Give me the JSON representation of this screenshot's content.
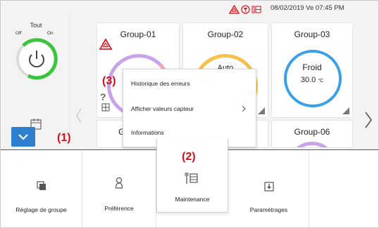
{
  "status_bar": {
    "datetime": "08/02/2019 Ve 07:45 PM",
    "icons": [
      "warning-icon",
      "filter-icon",
      "network-icon"
    ]
  },
  "master_control": {
    "label": "Tout",
    "off_label": "Off",
    "on_label": "On",
    "state": "on",
    "icon": "power-icon"
  },
  "groups": [
    {
      "name": "Group-01",
      "status_icon": "warning-icon",
      "extra_icons": [
        "help-icon",
        "grid-icon"
      ]
    },
    {
      "name": "Group-02",
      "mode": "Auto"
    },
    {
      "name": "Group-03",
      "mode": "Froid",
      "setpoint": "30.0",
      "unit": "°C"
    },
    {
      "name": "G"
    },
    {
      "name": ""
    },
    {
      "name": "Group-06"
    }
  ],
  "context_menu": {
    "items": [
      {
        "label": "Historique des erreurs",
        "has_submenu": false
      },
      {
        "label": "Afficher valeurs capteur",
        "has_submenu": true
      },
      {
        "label": "Informations",
        "has_submenu": false
      }
    ]
  },
  "bottom_menu": {
    "items": [
      {
        "label": "Réglage de groupe",
        "icon": "group-settings-icon"
      },
      {
        "label": "Préférence",
        "icon": "user-icon"
      },
      {
        "label": "Maintenance",
        "icon": "maintenance-icon",
        "selected": true
      },
      {
        "label": "Paramétrages",
        "icon": "download-icon"
      }
    ]
  },
  "annotations": {
    "a1": "(1)",
    "a2": "(2)",
    "a3": "(3)"
  },
  "colors": {
    "accent_blue": "#2f7fd0",
    "annotation_red": "#d8101c",
    "ring_purple": "#c9a3ea",
    "ring_yellow": "#f5c14a",
    "ring_blue": "#3aa0e8",
    "power_green": "#3cc43c"
  }
}
